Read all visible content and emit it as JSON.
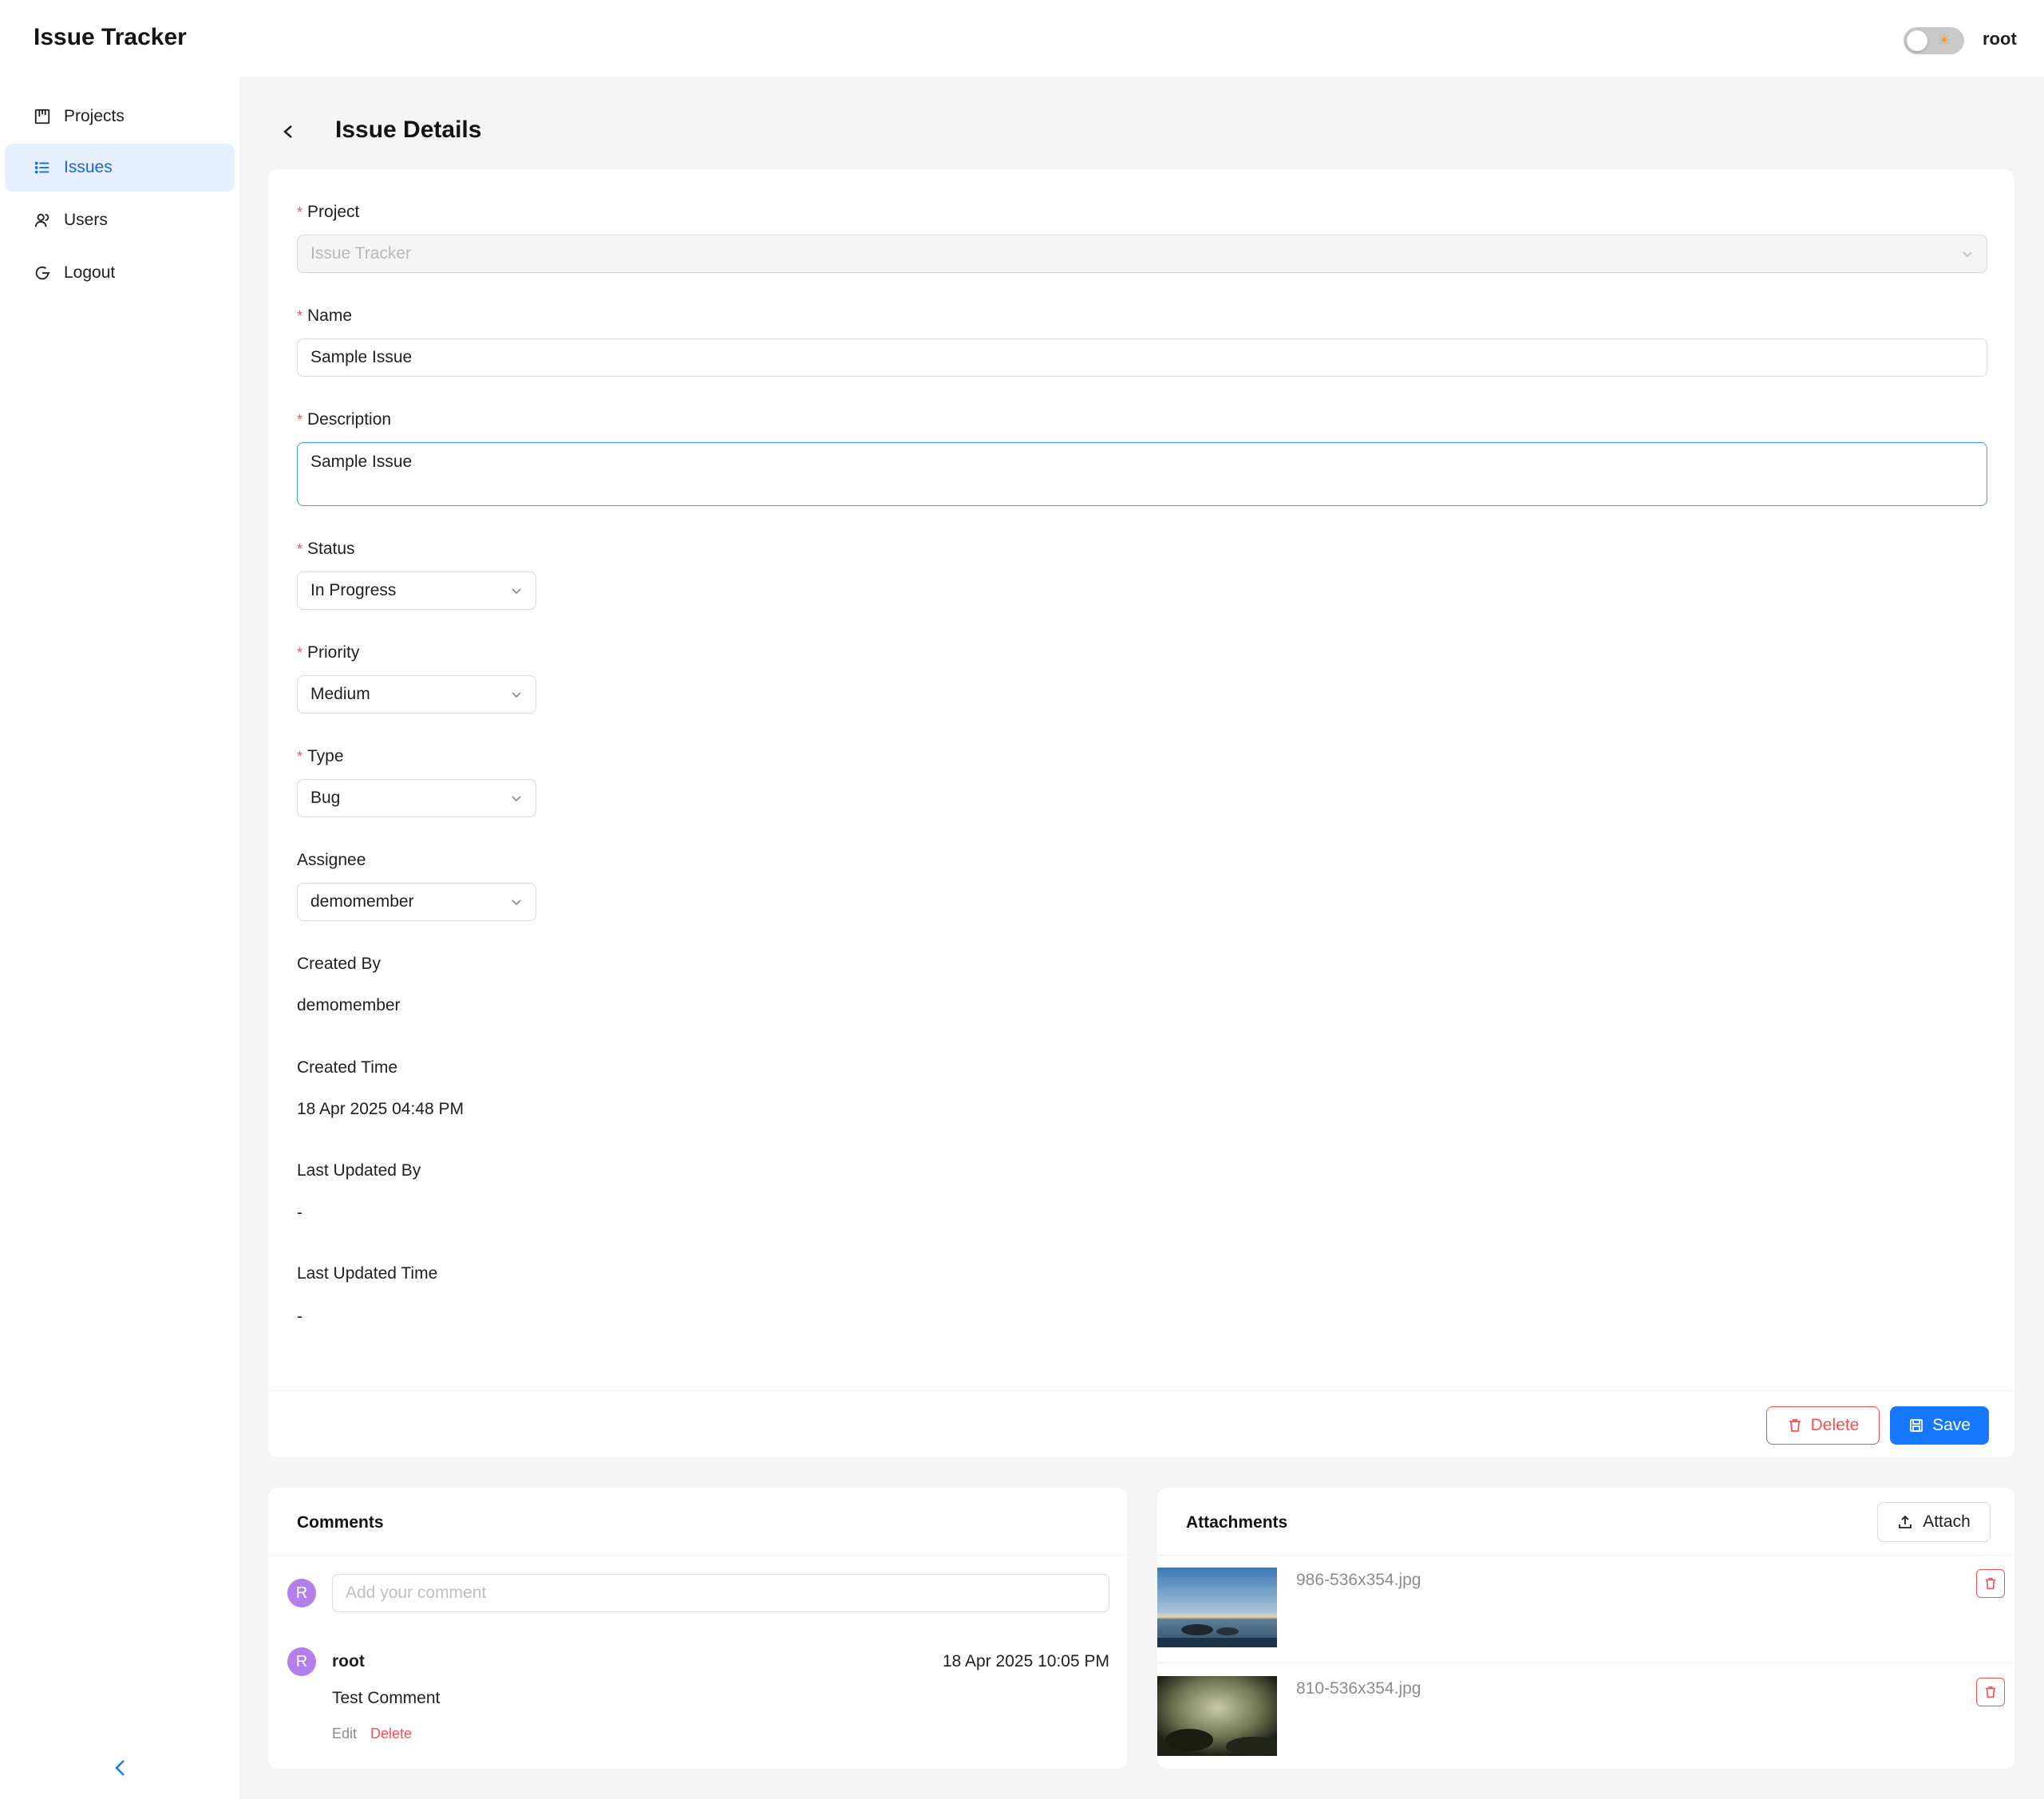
{
  "app": {
    "title": "Issue Tracker",
    "user": "root"
  },
  "sidebar": {
    "items": [
      {
        "label": "Projects",
        "icon": "project-board-icon"
      },
      {
        "label": "Issues",
        "icon": "list-icon"
      },
      {
        "label": "Users",
        "icon": "users-icon"
      },
      {
        "label": "Logout",
        "icon": "logout-icon"
      }
    ],
    "active": "Issues"
  },
  "page": {
    "title": "Issue Details"
  },
  "form": {
    "project": {
      "label": "Project",
      "value": "Issue Tracker"
    },
    "name": {
      "label": "Name",
      "value": "Sample Issue"
    },
    "description": {
      "label": "Description",
      "value": "Sample Issue"
    },
    "status": {
      "label": "Status",
      "value": "In Progress"
    },
    "priority": {
      "label": "Priority",
      "value": "Medium"
    },
    "type": {
      "label": "Type",
      "value": "Bug"
    },
    "assignee": {
      "label": "Assignee",
      "value": "demomember"
    },
    "created_by": {
      "label": "Created By",
      "value": "demomember"
    },
    "created_time": {
      "label": "Created Time",
      "value": "18 Apr 2025 04:48 PM"
    },
    "last_updated_by": {
      "label": "Last Updated By",
      "value": "-"
    },
    "last_updated_time": {
      "label": "Last Updated Time",
      "value": "-"
    },
    "required_mark": "*",
    "delete_label": "Delete",
    "save_label": "Save"
  },
  "comments": {
    "title": "Comments",
    "placeholder": "Add your comment",
    "avatar_initial": "R",
    "items": [
      {
        "initial": "R",
        "author": "root",
        "time": "18 Apr 2025 10:05 PM",
        "text": "Test Comment",
        "edit": "Edit",
        "delete": "Delete"
      }
    ]
  },
  "attachments": {
    "title": "Attachments",
    "attach_label": "Attach",
    "items": [
      {
        "name": "986-536x354.jpg"
      },
      {
        "name": "810-536x354.jpg"
      }
    ]
  },
  "colors": {
    "primary": "#1677ff",
    "danger": "#ff4d4f",
    "active_bg": "#e6f0ff",
    "avatar": "#b37feb"
  }
}
